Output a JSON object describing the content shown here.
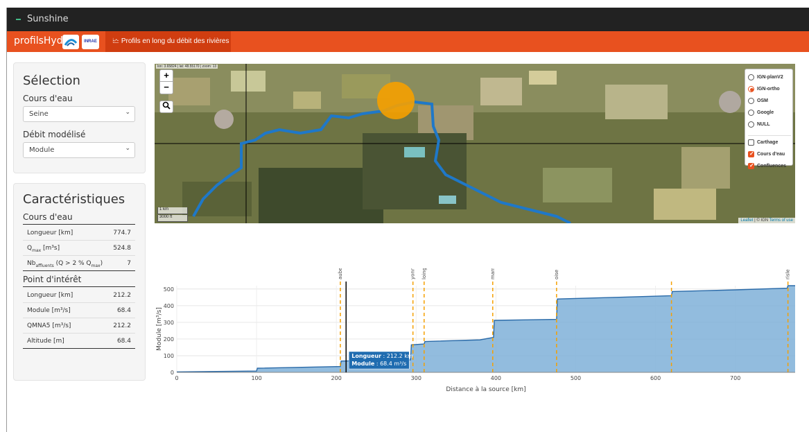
{
  "app": {
    "title": "Sunshine"
  },
  "navbar": {
    "brand": "profilsHydro",
    "partner_logo": "INRAE",
    "tab_label": "Profils en long du débit des rivières",
    "tab_icon": "line-chart-icon"
  },
  "selection": {
    "heading": "Sélection",
    "river_label": "Cours d'eau",
    "river_value": "Seine",
    "flow_label": "Débit modélisé",
    "flow_value": "Module"
  },
  "characteristics": {
    "heading": "Caractéristiques",
    "river_section": "Cours d'eau",
    "river_rows": [
      {
        "key": "Longueur [km]",
        "value": "774.7"
      },
      {
        "key_main": "Q",
        "key_sub": "max",
        "key_rest": " [m³s]",
        "value": "524.8"
      },
      {
        "key_main": "Nb",
        "key_sub": "affluents",
        "key_rest": " (Q > 2 % Q",
        "key_sub2": "max",
        "key_end": ")",
        "value": "7"
      }
    ],
    "poi_section": "Point d'intérêt",
    "poi_rows": [
      {
        "key": "Longueur [km]",
        "value": "212.2"
      },
      {
        "key": "Module [m³/s]",
        "value": "68.4"
      },
      {
        "key": "QMNA5 [m³/s]",
        "value": "212.2"
      },
      {
        "key": "Altitude [m]",
        "value": "68.4"
      }
    ]
  },
  "map": {
    "coords": "lon: 3.65824 | lat: 48.55170 | zoom: 13",
    "zoom_in": "+",
    "zoom_out": "−",
    "search_icon": "search-icon",
    "scale_km": "1 km",
    "scale_ft": "3000 ft",
    "attrib_leaflet": "Leaflet",
    "attrib_rest": " | © IGN ",
    "attrib_terms": "Terms of use",
    "river_color": "#1f78c8",
    "marker_color": "#f5a000",
    "layers": {
      "base": [
        {
          "label": "IGN-planV2",
          "selected": false
        },
        {
          "label": "IGN-ortho",
          "selected": true
        },
        {
          "label": "OSM",
          "selected": false
        },
        {
          "label": "Google",
          "selected": false
        },
        {
          "label": "NULL",
          "selected": false
        }
      ],
      "overlays": [
        {
          "label": "Carthage",
          "checked": false
        },
        {
          "label": "Cours d'eau",
          "checked": true
        },
        {
          "label": "Confluences",
          "checked": true
        }
      ]
    }
  },
  "chart_data": {
    "type": "area",
    "xlabel": "Distance à la source [km]",
    "ylabel": "Module [m³/s]",
    "xlim": [
      0,
      775
    ],
    "ylim": [
      0,
      520
    ],
    "xticks": [
      0,
      100,
      200,
      300,
      400,
      500,
      600,
      700
    ],
    "yticks": [
      0,
      100,
      200,
      300,
      400,
      500
    ],
    "fill_color": "#7fb0d8",
    "line_color": "#2a6aa8",
    "confluence_color": "#f5a000",
    "x": [
      0,
      100,
      101,
      205,
      206,
      293,
      294,
      310,
      311,
      380,
      397,
      398,
      476,
      477,
      550,
      620,
      621,
      700,
      765,
      766,
      775
    ],
    "y": [
      3,
      8,
      25,
      35,
      68,
      75,
      165,
      170,
      185,
      195,
      210,
      312,
      318,
      440,
      450,
      460,
      485,
      495,
      505,
      520,
      520
    ],
    "confluences": [
      {
        "name": "aube",
        "x": 205
      },
      {
        "name": "yonne",
        "x": 296
      },
      {
        "name": "loing",
        "x": 310
      },
      {
        "name": "marne",
        "x": 396
      },
      {
        "name": "oise",
        "x": 476
      },
      {
        "name": "",
        "x": 620
      },
      {
        "name": "risle",
        "x": 766
      }
    ],
    "cursor_x": 212.2,
    "tooltip": {
      "line1_label": "Longueur",
      "line1_value": " : 212.2 km",
      "line2_label": "Module",
      "line2_value": " : 68.4 m³/s"
    }
  }
}
